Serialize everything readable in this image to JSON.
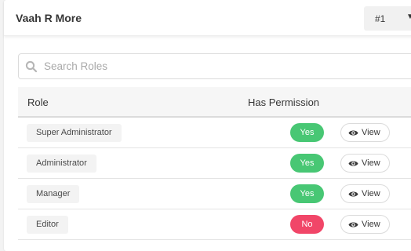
{
  "header": {
    "title": "Vaah R More",
    "page_select": {
      "value": "#1",
      "chevron_icon": "caret-down-icon"
    }
  },
  "search": {
    "placeholder": "Search Roles",
    "value": "",
    "icon": "search-icon"
  },
  "table": {
    "columns": [
      "Role",
      "Has Permission"
    ],
    "rows": [
      {
        "role": "Super Administrator",
        "permission": "Yes",
        "action": "View"
      },
      {
        "role": "Administrator",
        "permission": "Yes",
        "action": "View"
      },
      {
        "role": "Manager",
        "permission": "Yes",
        "action": "View"
      },
      {
        "role": "Editor",
        "permission": "No",
        "action": "View"
      }
    ]
  },
  "colors": {
    "yes": "#48c774",
    "no": "#f14668",
    "accent_text": "#363636"
  }
}
